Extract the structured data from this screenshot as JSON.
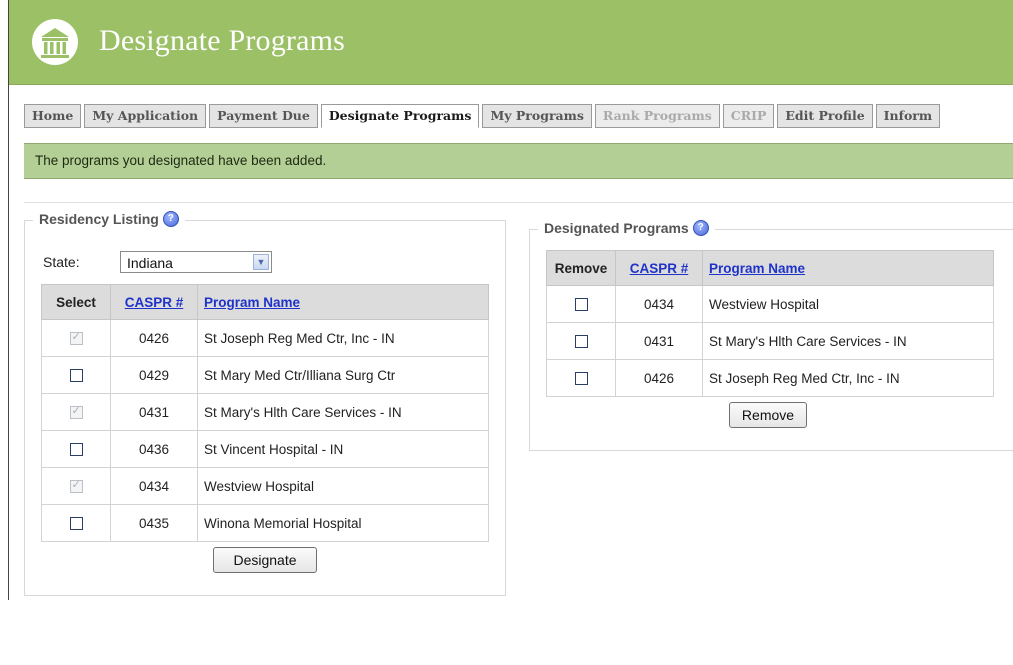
{
  "header": {
    "title": "Designate Programs",
    "logo_icon": "building-columns-icon",
    "background": "#9bc066"
  },
  "tabs": [
    {
      "label": "Home",
      "state": "normal"
    },
    {
      "label": "My Application",
      "state": "normal"
    },
    {
      "label": "Payment Due",
      "state": "normal"
    },
    {
      "label": "Designate Programs",
      "state": "active"
    },
    {
      "label": "My Programs",
      "state": "normal"
    },
    {
      "label": "Rank Programs",
      "state": "disabled"
    },
    {
      "label": "CRIP",
      "state": "disabled"
    },
    {
      "label": "Edit Profile",
      "state": "normal"
    },
    {
      "label": "Inform",
      "state": "normal"
    }
  ],
  "message": {
    "text": "The programs you designated have been added.",
    "background": "#b4cf95"
  },
  "residency_listing": {
    "legend": "Residency Listing",
    "state_label": "State:",
    "state_value": "Indiana",
    "columns": [
      "Select",
      "CASPR #",
      "Program Name"
    ],
    "rows": [
      {
        "code": "0426",
        "name": "St Joseph Reg Med Ctr, Inc - IN",
        "checkbox": "checked-disabled"
      },
      {
        "code": "0429",
        "name": "St Mary Med Ctr/Illiana Surg Ctr",
        "checkbox": "unchecked"
      },
      {
        "code": "0431",
        "name": "St Mary's Hlth Care Services - IN",
        "checkbox": "checked-disabled"
      },
      {
        "code": "0436",
        "name": "St Vincent Hospital - IN",
        "checkbox": "unchecked"
      },
      {
        "code": "0434",
        "name": "Westview Hospital",
        "checkbox": "checked-disabled"
      },
      {
        "code": "0435",
        "name": "Winona Memorial Hospital",
        "checkbox": "unchecked"
      }
    ],
    "button_label": "Designate"
  },
  "designated_programs": {
    "legend": "Designated Programs",
    "columns": [
      "Remove",
      "CASPR #",
      "Program Name"
    ],
    "rows": [
      {
        "code": "0434",
        "name": "Westview Hospital",
        "checkbox": "unchecked"
      },
      {
        "code": "0431",
        "name": "St Mary's Hlth Care Services - IN",
        "checkbox": "unchecked"
      },
      {
        "code": "0426",
        "name": "St Joseph Reg Med Ctr, Inc - IN",
        "checkbox": "unchecked"
      }
    ],
    "button_label": "Remove"
  }
}
